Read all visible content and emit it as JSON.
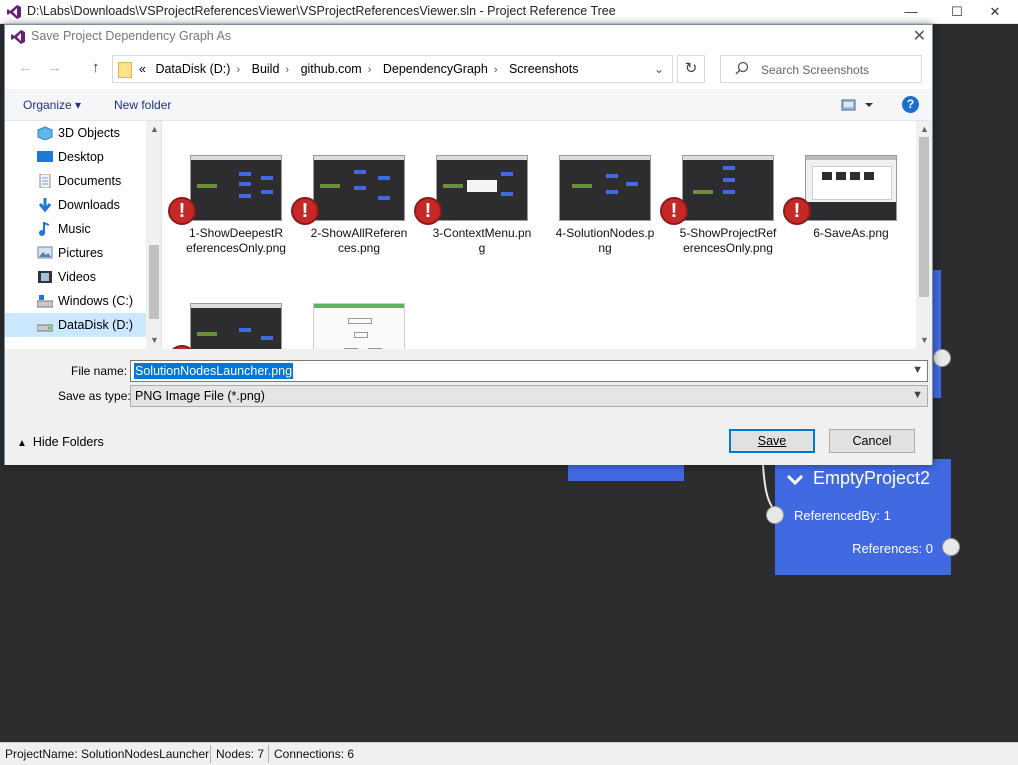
{
  "window": {
    "title": "D:\\Labs\\Downloads\\VSProjectReferencesViewer\\VSProjectReferencesViewer.sln - Project Reference Tree",
    "controls": {
      "minimize": "—",
      "maximize": "☐",
      "close": "✕"
    }
  },
  "graph": {
    "node": {
      "title": "EmptyProject2",
      "referenced_by": "ReferencedBy: 1",
      "references": "References: 0"
    }
  },
  "status": {
    "project_name": "ProjectName: SolutionNodesLauncher",
    "nodes": "Nodes: 7",
    "connections": "Connections: 6"
  },
  "dialog": {
    "title": "Save Project Dependency Graph As",
    "close": "✕",
    "nav": {
      "back": "←",
      "forward": "→",
      "up": "↑",
      "refresh": "↻",
      "prefix": "«"
    },
    "breadcrumb": [
      "DataDisk (D:)",
      "Build",
      "github.com",
      "DependencyGraph",
      "Screenshots"
    ],
    "search_placeholder": "Search Screenshots",
    "toolbar": {
      "organize": "Organize ▾",
      "new_folder": "New folder",
      "help": "?"
    },
    "nav_items": [
      {
        "label": "3D Objects",
        "icon": "3d-objects-icon"
      },
      {
        "label": "Desktop",
        "icon": "desktop-icon"
      },
      {
        "label": "Documents",
        "icon": "documents-icon"
      },
      {
        "label": "Downloads",
        "icon": "downloads-icon"
      },
      {
        "label": "Music",
        "icon": "music-icon"
      },
      {
        "label": "Pictures",
        "icon": "pictures-icon"
      },
      {
        "label": "Videos",
        "icon": "videos-icon"
      },
      {
        "label": "Windows (C:)",
        "icon": "drive-icon"
      },
      {
        "label": "DataDisk (D:)",
        "icon": "drive-icon",
        "selected": true
      }
    ],
    "files": [
      {
        "name": "1-ShowDeepestReferencesOnly.png",
        "warning": true
      },
      {
        "name": "2-ShowAllReferences.png",
        "warning": true
      },
      {
        "name": "3-ContextMenu.png",
        "warning": true
      },
      {
        "name": "4-SolutionNodes.png",
        "warning": false
      },
      {
        "name": "5-ShowProjectReferencesOnly.png",
        "warning": true
      },
      {
        "name": "6-SaveAs.png",
        "warning": true
      },
      {
        "name": "",
        "warning": true
      },
      {
        "name": "",
        "warning": false
      }
    ],
    "file_name_label": "File name:",
    "file_name_value": "SolutionNodesLauncher.png",
    "save_type_label": "Save as type:",
    "save_type_value": "PNG Image File (*.png)",
    "hide_folders": "Hide Folders",
    "save_button": "Save",
    "cancel_button": "Cancel"
  },
  "colors": {
    "node_blue": "#4169e1",
    "canvas": "#2d2d30",
    "selection": "#0078d7",
    "warning_red": "#c62828"
  }
}
